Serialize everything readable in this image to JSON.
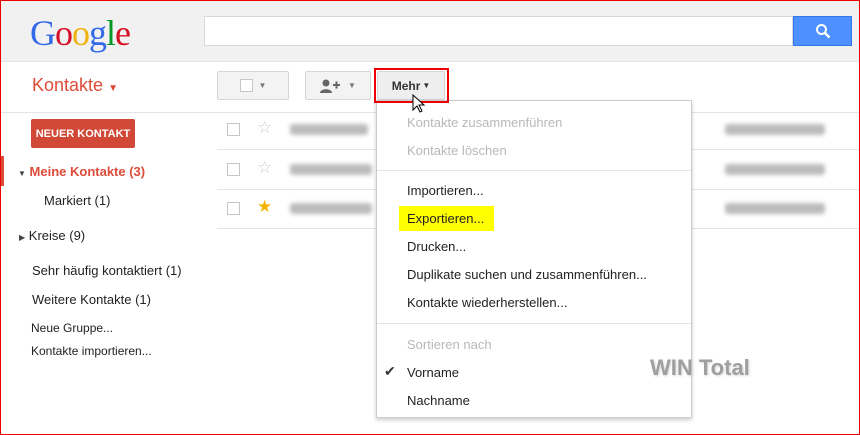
{
  "header": {
    "logo": "Google",
    "search_placeholder": ""
  },
  "app": {
    "title": "Kontakte"
  },
  "toolbar": {
    "more_label": "Mehr"
  },
  "sidebar": {
    "new_contact": "NEUER KONTAKT",
    "my_contacts": "Meine Kontakte (3)",
    "starred": "Markiert (1)",
    "circles": "Kreise (9)",
    "frequent": "Sehr häufig kontaktiert (1)",
    "other": "Weitere Kontakte (1)",
    "new_group": "Neue Gruppe...",
    "import": "Kontakte importieren..."
  },
  "contacts": [
    {
      "starred": false
    },
    {
      "starred": false
    },
    {
      "starred": true
    }
  ],
  "menu": {
    "merge": "Kontakte zusammenführen",
    "delete": "Kontakte löschen",
    "import": "Importieren...",
    "export": "Exportieren...",
    "print": "Drucken...",
    "duplicates": "Duplikate suchen und zusammenführen...",
    "restore": "Kontakte wiederherstellen...",
    "sort_by": "Sortieren nach",
    "first_name": "Vorname",
    "last_name": "Nachname"
  },
  "watermark": "WIN Total",
  "colors": {
    "accent": "#dd4b39",
    "search": "#4d90fe",
    "highlight": "#ffff00"
  }
}
